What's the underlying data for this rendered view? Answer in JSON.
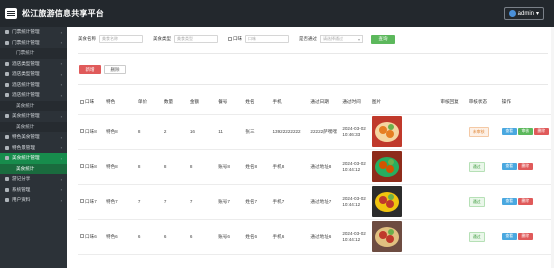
{
  "app": {
    "title": "松江旅游信息共享平台",
    "user": "admin"
  },
  "sidebar": {
    "items": [
      {
        "label": "门票统计管理",
        "active": false
      },
      {
        "label": "门票统计管理",
        "active": false
      },
      {
        "label": "门票统计",
        "active": false,
        "sub": true
      },
      {
        "label": "酒店类型管理",
        "active": false
      },
      {
        "label": "酒店类型管理",
        "active": false
      },
      {
        "label": "酒店统计管理",
        "active": false
      },
      {
        "label": "酒店统计管理",
        "active": false
      },
      {
        "label": "美食统计",
        "active": false,
        "sub": true
      },
      {
        "label": "美食统计管理",
        "active": false
      },
      {
        "label": "美食统计",
        "active": false,
        "sub": true
      },
      {
        "label": "特色美食管理",
        "active": false
      },
      {
        "label": "特色景管理",
        "active": false
      },
      {
        "label": "美食统计管理",
        "active": true
      },
      {
        "label": "美食统计",
        "active": true,
        "sub": true
      },
      {
        "label": "游记分享",
        "active": false
      },
      {
        "label": "系统管理",
        "active": false
      },
      {
        "label": "用户资料",
        "active": false
      }
    ]
  },
  "search": {
    "name_label": "美食名称",
    "name_placeholder": "美食名称",
    "type_label": "美食类型",
    "type_placeholder": "美食类型",
    "id_label": "口味",
    "id_placeholder": "口味",
    "status_label": "是否通过",
    "status_placeholder": "请选择通过",
    "button": "查询"
  },
  "toolbar": {
    "add": "新增",
    "delete": "删除"
  },
  "table": {
    "headers": [
      "口味",
      "特色",
      "单价",
      "数量",
      "金额",
      "餐号",
      "姓名",
      "手机",
      "通过日期",
      "通过时间",
      "图片",
      "审核回复",
      "审核状态",
      "操作"
    ],
    "rows": [
      {
        "c1": "口味8",
        "c2": "特色8",
        "c3": "8",
        "c4": "2",
        "c5": "16",
        "c6": "11",
        "c7": "张三",
        "c8": "13922222222",
        "c9": "22222萨嘿嘿",
        "c10": "2024-03-02 10:46:33",
        "status": "未审核",
        "status_type": "pending",
        "actions": [
          "查看",
          "审核",
          "删除"
        ]
      },
      {
        "c1": "口味8",
        "c2": "特色8",
        "c3": "8",
        "c4": "8",
        "c5": "8",
        "c6": "账号8",
        "c7": "姓名8",
        "c8": "手机8",
        "c9": "通过地址8",
        "c10": "2024-03-02 10:44:12",
        "status": "通过",
        "status_type": "ok",
        "actions": [
          "查看",
          "删除"
        ]
      },
      {
        "c1": "口味7",
        "c2": "特色7",
        "c3": "7",
        "c4": "7",
        "c5": "7",
        "c6": "账号7",
        "c7": "姓名7",
        "c8": "手机7",
        "c9": "通过地址7",
        "c10": "2024-03-02 10:44:12",
        "status": "通过",
        "status_type": "ok",
        "actions": [
          "查看",
          "删除"
        ]
      },
      {
        "c1": "口味6",
        "c2": "特色6",
        "c3": "6",
        "c4": "6",
        "c5": "6",
        "c6": "账号6",
        "c7": "姓名6",
        "c8": "手机6",
        "c9": "通过地址6",
        "c10": "2024-03-02 10:44:12",
        "status": "通过",
        "status_type": "ok",
        "actions": [
          "查看",
          "删除"
        ]
      }
    ]
  }
}
